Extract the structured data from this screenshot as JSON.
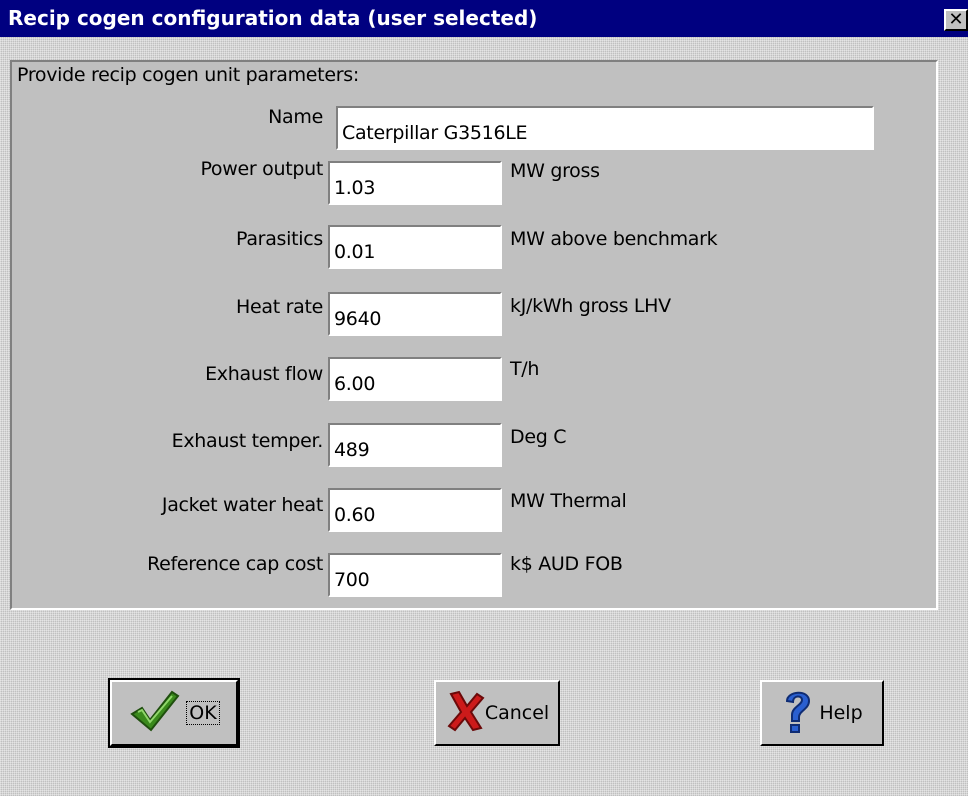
{
  "window": {
    "title": "Recip cogen configuration data (user selected)",
    "close_glyph": "✕"
  },
  "panel": {
    "header": "Provide recip cogen unit parameters:"
  },
  "fields": [
    {
      "label": "Name",
      "value": "Caterpillar G3516LE",
      "unit": ""
    },
    {
      "label": "Power output",
      "value": "1.03",
      "unit": "MW gross"
    },
    {
      "label": "Parasitics",
      "value": "0.01",
      "unit": "MW above benchmark"
    },
    {
      "label": "Heat rate",
      "value": "9640",
      "unit": "kJ/kWh gross LHV"
    },
    {
      "label": "Exhaust flow",
      "value": "6.00",
      "unit": "T/h"
    },
    {
      "label": "Exhaust temper.",
      "value": "489",
      "unit": "Deg C"
    },
    {
      "label": "Jacket water heat",
      "value": "0.60",
      "unit": "MW Thermal"
    },
    {
      "label": "Reference cap cost",
      "value": "700",
      "unit": "k$ AUD FOB"
    }
  ],
  "buttons": {
    "ok": "OK",
    "cancel": "Cancel",
    "help": "Help"
  },
  "icons": {
    "ok": "checkmark-icon",
    "cancel": "red-x-icon",
    "help": "question-mark-icon"
  },
  "colors": {
    "titlebar": "#000080",
    "face": "#c0c0c0",
    "ok_check": "#3a8a1c",
    "cancel_x": "#cc1a1a",
    "help_q": "#2a5fd0"
  }
}
